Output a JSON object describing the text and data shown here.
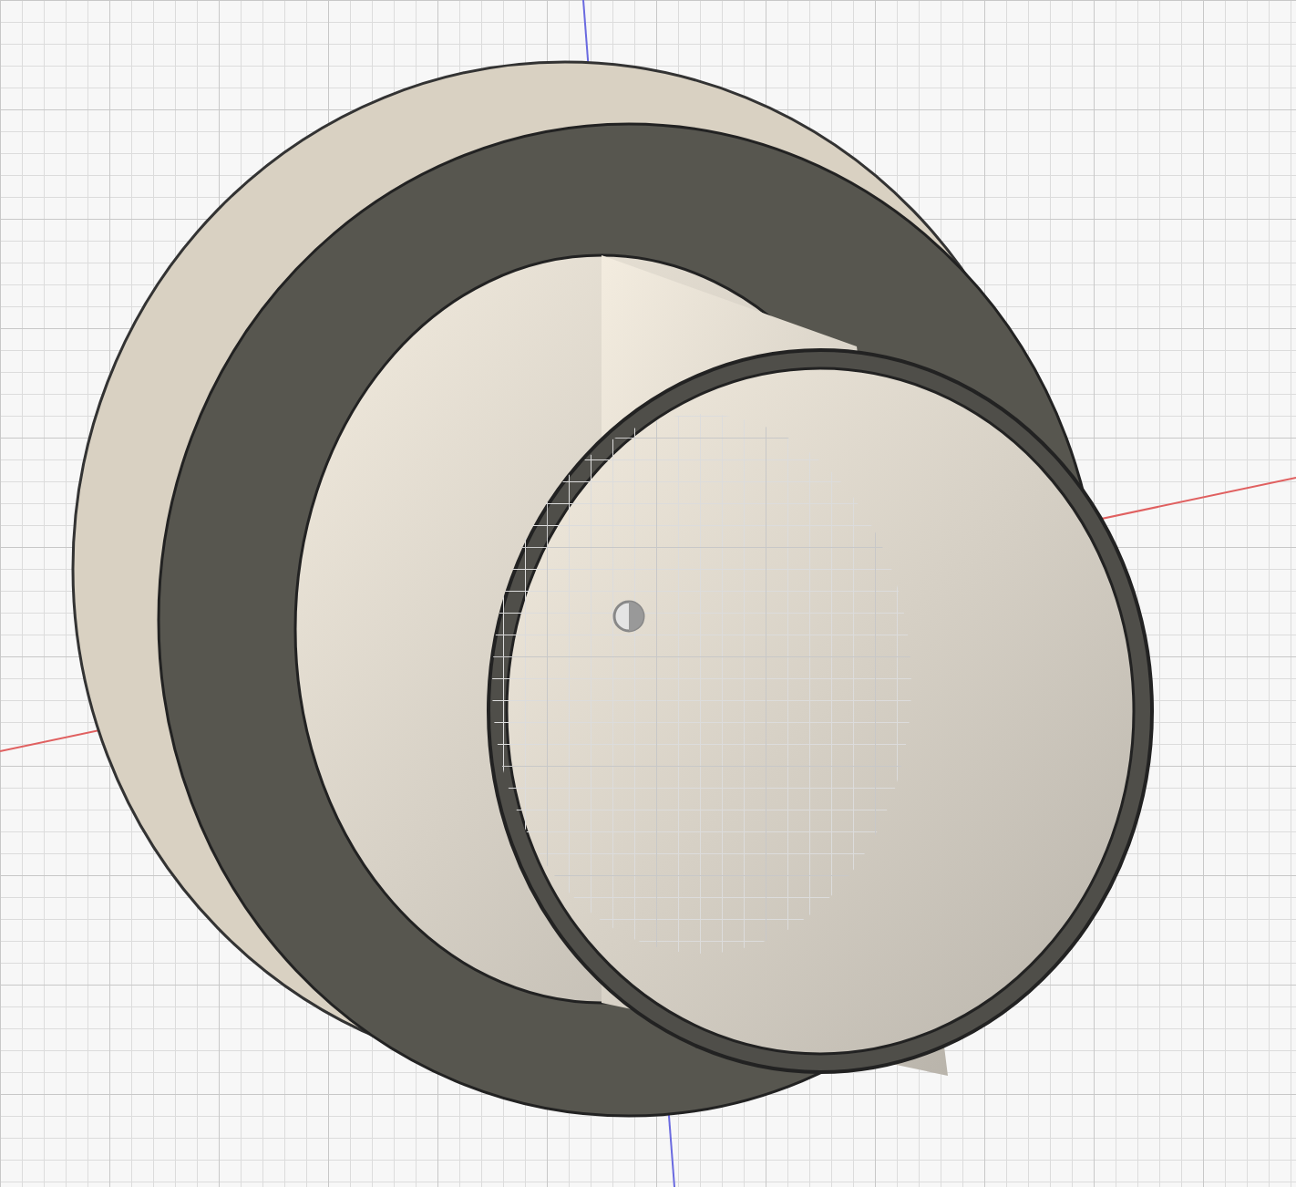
{
  "viewport": {
    "kind": "model",
    "model": {
      "kind": "flanged-tube"
    }
  }
}
